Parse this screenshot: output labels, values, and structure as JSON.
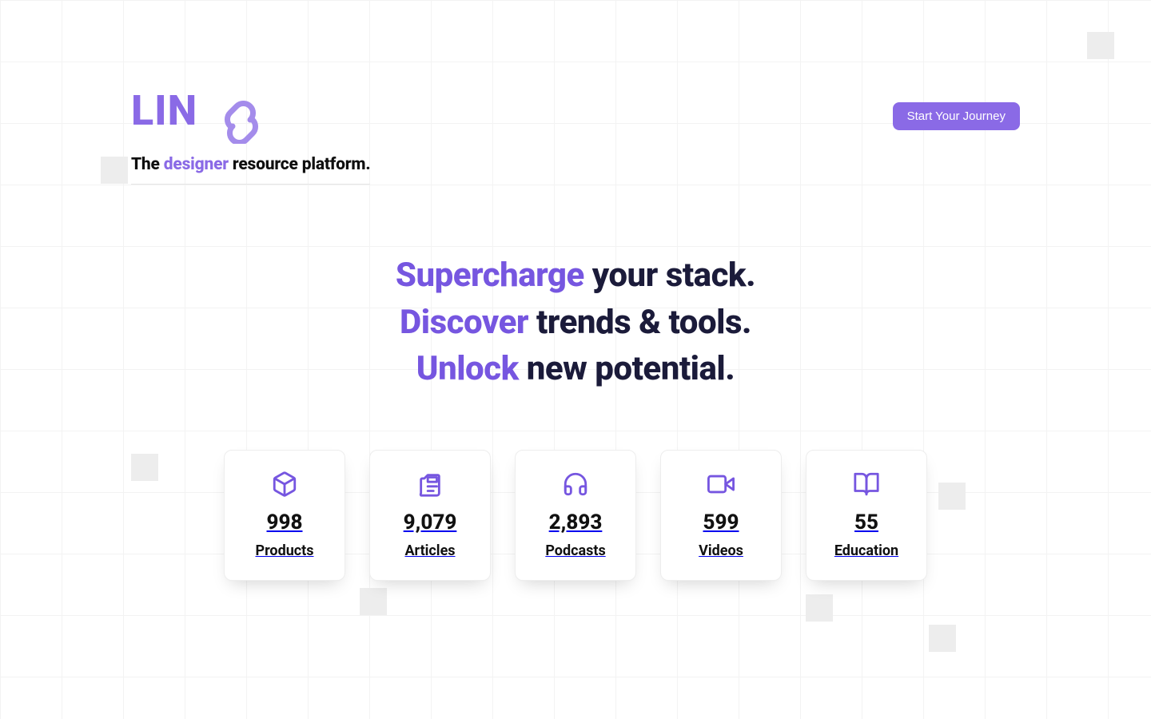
{
  "brand": {
    "logo_text": "LIN",
    "tagline_pre": "The ",
    "tagline_accent": "designer",
    "tagline_post": " resource platform."
  },
  "cta": {
    "label": "Start Your Journey"
  },
  "hero": {
    "lines": [
      {
        "keyword": "Supercharge",
        "rest": " your stack."
      },
      {
        "keyword": "Discover",
        "rest": " trends & tools."
      },
      {
        "keyword": "Unlock",
        "rest": " new potential."
      }
    ]
  },
  "stats": [
    {
      "icon": "box-icon",
      "count": "998",
      "label": "Products"
    },
    {
      "icon": "newspaper-icon",
      "count": "9,079",
      "label": "Articles"
    },
    {
      "icon": "headphones-icon",
      "count": "2,893",
      "label": "Podcasts"
    },
    {
      "icon": "video-icon",
      "count": "599",
      "label": "Videos"
    },
    {
      "icon": "book-icon",
      "count": "55",
      "label": "Education"
    }
  ],
  "colors": {
    "accent": "#8a6ae6",
    "text_dark": "#1b1b3a"
  }
}
